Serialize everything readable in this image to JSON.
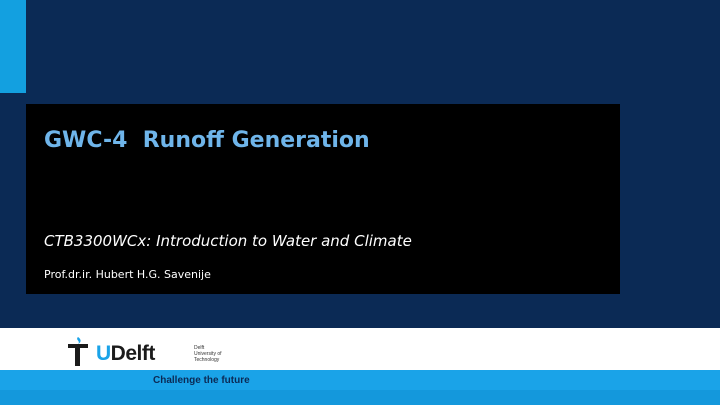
{
  "slide": {
    "title": "GWC-4  Runoff Generation",
    "subtitle": "CTB3300WCx: Introduction to Water and Climate",
    "author": "Prof.dr.ir. Hubert H.G. Savenije"
  },
  "footer": {
    "logo_word_prefix": "T",
    "logo_word_u": "U",
    "logo_word_suffix": "Delft",
    "logo_small_line1": "Delft",
    "logo_small_line2": "University of",
    "logo_small_line3": "Technology",
    "tagline": "Challenge the future"
  },
  "colors": {
    "background": "#0b2a55",
    "accent": "#13a0e0",
    "title": "#6fb5ea",
    "footer_blue": "#1aa3e8"
  }
}
